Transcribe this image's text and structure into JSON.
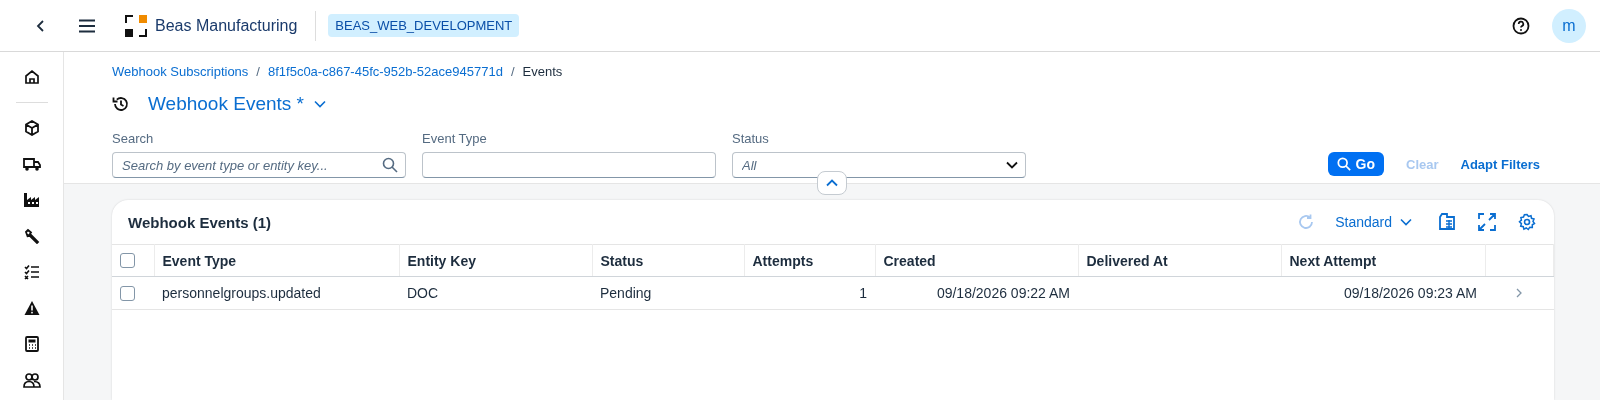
{
  "header": {
    "brand": "Beas Manufacturing",
    "system": "BEAS_WEB_DEVELOPMENT",
    "avatar": "m"
  },
  "breadcrumbs": [
    {
      "label": "Webhook Subscriptions",
      "kind": "link"
    },
    {
      "label": "/",
      "kind": "separator"
    },
    {
      "label": "8f1f5c0a-c867-45fc-952b-52ace945771d",
      "kind": "link"
    },
    {
      "label": "/",
      "kind": "separator"
    },
    {
      "label": "Events",
      "kind": "current"
    }
  ],
  "page_title": "Webhook Events *",
  "filters": [
    {
      "label": "Search",
      "kind": "search",
      "placeholder": "Search by event type or entity key..."
    },
    {
      "label": "Event Type",
      "kind": "input"
    },
    {
      "label": "Status",
      "kind": "select",
      "placeholder": "All"
    }
  ],
  "filter_actions": [
    {
      "label": "Go",
      "kind": "primary",
      "disabled": false
    },
    {
      "label": "Clear",
      "kind": "link",
      "disabled": true
    },
    {
      "label": "Adapt Filters",
      "kind": "link",
      "disabled": false
    }
  ],
  "table": {
    "title": "Webhook Events (1)",
    "variant": "Standard",
    "all_checked": false,
    "columns": [
      {
        "label": "Event Type",
        "kind": "text"
      },
      {
        "label": "Entity Key",
        "kind": "text"
      },
      {
        "label": "Status",
        "kind": "text"
      },
      {
        "label": "Attempts",
        "kind": "number"
      },
      {
        "label": "Created",
        "kind": "number"
      },
      {
        "label": "Delivered At",
        "kind": "number"
      },
      {
        "label": "Next Attempt",
        "kind": "number"
      }
    ],
    "rows": [
      {
        "checked": false,
        "cells": [
          "personnelgroups.updated",
          "DOC",
          "Pending",
          "1",
          "09/18/2026 09:22 AM",
          "",
          "09/18/2026 09:23 AM"
        ]
      }
    ]
  }
}
